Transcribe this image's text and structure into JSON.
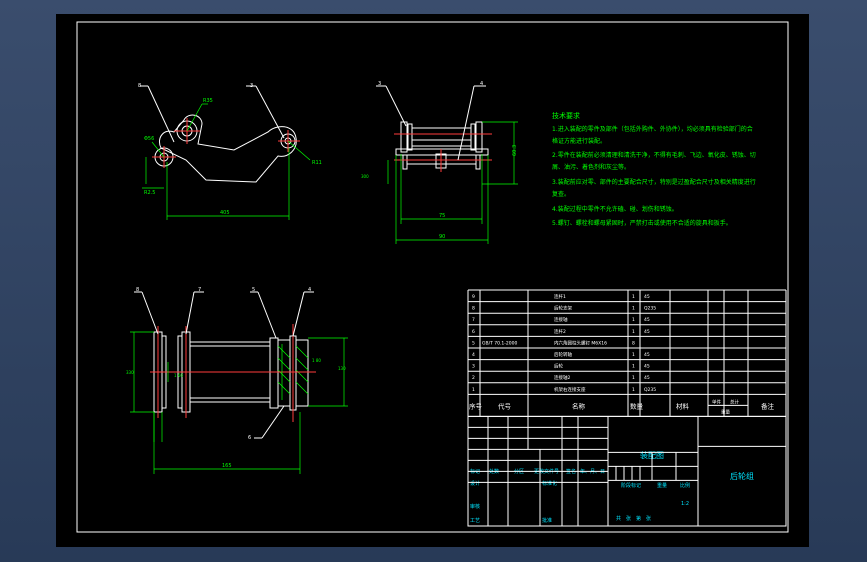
{
  "colors": {
    "frame": "#ffffff",
    "dimension": "#00ff00",
    "centerline": "#ff3b3b",
    "text": "#00ff00",
    "table_text": "#00e5ff"
  },
  "view1": {
    "balloons": [
      "8",
      "3"
    ],
    "dims": [
      "R35",
      "Φ56",
      "R11",
      "R2.5",
      "405"
    ]
  },
  "view2": {
    "balloons": [
      "3",
      "4"
    ],
    "dims": [
      "300",
      "60.3",
      "75",
      "90"
    ]
  },
  "view3": {
    "balloons": [
      "8",
      "7",
      "6",
      "5",
      "4"
    ],
    "dims": [
      "330",
      "1 60",
      "1 80",
      "130",
      "165"
    ]
  },
  "tech_req": {
    "title": "技术要求",
    "lines": [
      "1.进入装配的零件及部件（包括外购件、外协件），均必须具有检验部门的合",
      "格证方能进行装配。",
      "2.零件在装配前必须清理和清洗干净，不得有毛刺、飞边、氧化皮、锈蚀、切",
      "屑、油污、着色剂和灰尘等。",
      "3.装配前应对零、部件的主要配合尺寸，特别是过盈配合尺寸及相关精度进行",
      "复查。",
      "4.装配过程中零件不允许磕、碰、划伤和锈蚀。",
      "5.螺钉、螺栓和螺母紧固时，严禁打击或使用不合适的旋具和扳手。"
    ]
  },
  "parts": [
    {
      "no": "9",
      "code": "",
      "name": "连杆1",
      "qty": "1",
      "mat": "45"
    },
    {
      "no": "8",
      "code": "",
      "name": "后轮支架",
      "qty": "1",
      "mat": "Q235"
    },
    {
      "no": "7",
      "code": "",
      "name": "连接轴",
      "qty": "1",
      "mat": "45"
    },
    {
      "no": "6",
      "code": "",
      "name": "连杆2",
      "qty": "1",
      "mat": "45"
    },
    {
      "no": "5",
      "code": "GB/T 70.1-2000",
      "name": "内六角圆柱头螺钉 M6X16",
      "qty": "8",
      "mat": ""
    },
    {
      "no": "4",
      "code": "",
      "name": "后轮转轴",
      "qty": "1",
      "mat": "45"
    },
    {
      "no": "3",
      "code": "",
      "name": "后轮",
      "qty": "1",
      "mat": "45"
    },
    {
      "no": "2",
      "code": "",
      "name": "连接轴2",
      "qty": "1",
      "mat": "45"
    },
    {
      "no": "1",
      "code": "",
      "name": "机架右连接支座",
      "qty": "1",
      "mat": "Q235"
    }
  ],
  "parts_header": {
    "no": "序号",
    "code": "代号",
    "name": "名称",
    "qty": "数量",
    "mat": "材料",
    "unit": "单件",
    "total": "总计",
    "weight": "重量",
    "note": "备注"
  },
  "title_block": {
    "drawing_name": "装配图",
    "part_name": "后轮组",
    "row_labels": [
      "标记",
      "处数",
      "分区",
      "更改文件号",
      "签名",
      "年、月、日"
    ],
    "design": "设计",
    "std": "标准化",
    "stage": "阶段标记",
    "weight": "重量",
    "scale_label": "比例",
    "scale": "1:2",
    "audit": "审核",
    "process": "工艺",
    "approve": "批准",
    "sheets": "共　张　第　张"
  }
}
